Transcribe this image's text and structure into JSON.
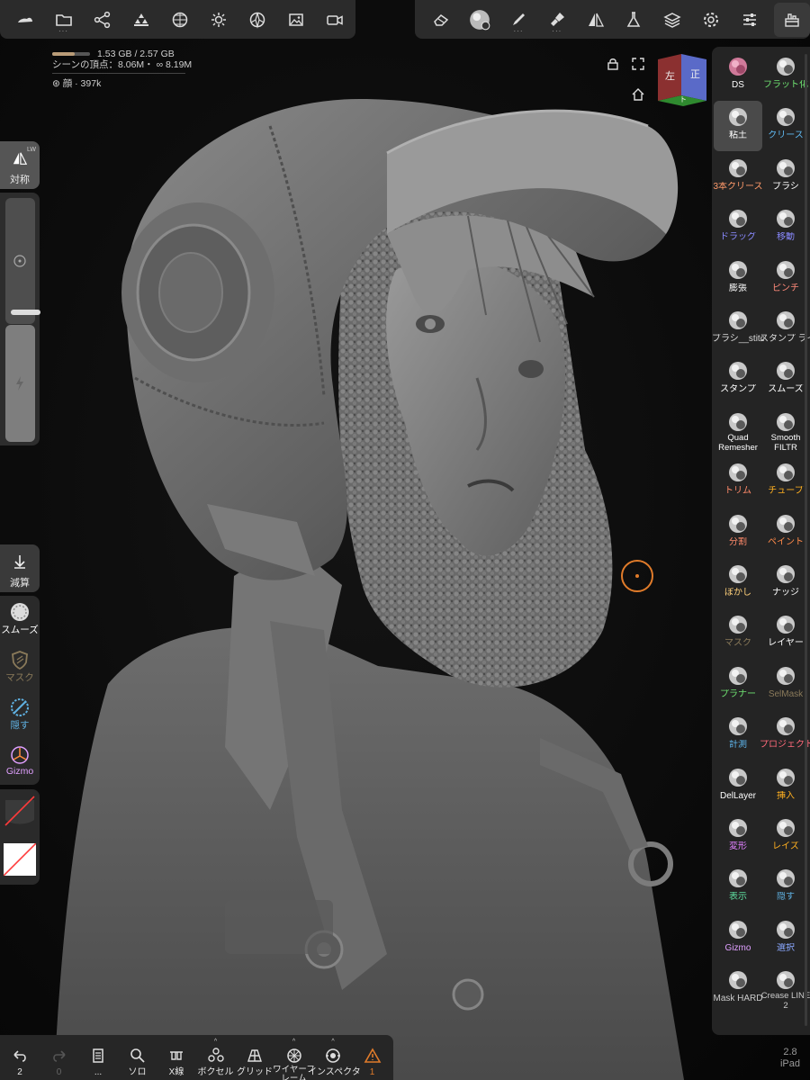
{
  "top_left_toolbar": [
    {
      "name": "cloud-icon",
      "dots": ""
    },
    {
      "name": "folder-icon",
      "dots": "···"
    },
    {
      "name": "scene-graph-icon",
      "dots": ""
    },
    {
      "name": "topology-icon",
      "dots": ""
    },
    {
      "name": "globe-icon",
      "dots": ""
    },
    {
      "name": "light-icon",
      "dots": ""
    },
    {
      "name": "material-icon",
      "dots": ""
    },
    {
      "name": "image-icon",
      "dots": ""
    },
    {
      "name": "video-icon",
      "dots": ""
    }
  ],
  "top_right_toolbar": [
    {
      "name": "eraser-icon",
      "dots": ""
    },
    {
      "name": "material-sphere-icon",
      "dots": ""
    },
    {
      "name": "brush-pen-icon",
      "dots": "···"
    },
    {
      "name": "paint-brush-icon",
      "dots": "···"
    },
    {
      "name": "symmetry-icon",
      "dots": ""
    },
    {
      "name": "flask-icon",
      "dots": ""
    },
    {
      "name": "layers-icon",
      "dots": ""
    },
    {
      "name": "settings-icon",
      "dots": ""
    },
    {
      "name": "sliders-icon",
      "dots": ""
    },
    {
      "name": "toolbox-icon",
      "dots": ""
    }
  ],
  "stats": {
    "memory": "1.53 GB / 2.57 GB",
    "memory_fraction": 0.6,
    "scene_vertices": "シーンの頂点：8.06M・",
    "link_count": "8.19M",
    "mesh_name": "顔",
    "mesh_count": "· 397k"
  },
  "nav_cube": {
    "left": "左",
    "front": "正",
    "bottom": "ト"
  },
  "left_panel": {
    "symmetry_label": "対称",
    "symmetry_tag": "LW",
    "radius_fraction": 0.93,
    "decimate_label": "減算",
    "tools": [
      {
        "label": "スムーズ",
        "color": "#ffffff"
      },
      {
        "label": "マスク",
        "color": "#8a7a5a"
      },
      {
        "label": "隠す",
        "color": "#5fb0e0"
      },
      {
        "label": "Gizmo",
        "color": "#e0a0ff"
      }
    ]
  },
  "right_tools": [
    {
      "label": "DS",
      "color": "#ffffff",
      "icon": "ds-icon",
      "selected": false
    },
    {
      "label": "フラット化",
      "color": "#6ee070",
      "icon": "flatten-icon",
      "selected": false
    },
    {
      "label": "粘土",
      "color": "#ffffff",
      "icon": "clay-icon",
      "selected": true
    },
    {
      "label": "クリース",
      "color": "#5fb8f0",
      "icon": "crease-icon",
      "selected": false
    },
    {
      "label": "3本クリース",
      "color": "#ff9a6a",
      "icon": "triple-crease-icon",
      "selected": false
    },
    {
      "label": "ブラシ",
      "color": "#ffffff",
      "icon": "brush-icon",
      "selected": false
    },
    {
      "label": "ドラッグ",
      "color": "#8a8aff",
      "icon": "drag-icon",
      "selected": false
    },
    {
      "label": "移動",
      "color": "#8a8aff",
      "icon": "move-icon",
      "selected": false
    },
    {
      "label": "膨張",
      "color": "#ffffff",
      "icon": "inflate-icon",
      "selected": false
    },
    {
      "label": "ピンチ",
      "color": "#ff8a7a",
      "icon": "pinch-icon",
      "selected": false
    },
    {
      "label": "ブラシ__stitch",
      "color": "#dddddd",
      "icon": "brush-stitch-icon",
      "selected": false
    },
    {
      "label": "スタンプ ライン",
      "color": "#dddddd",
      "icon": "stamp-line-icon",
      "selected": false
    },
    {
      "label": "スタンプ",
      "color": "#ffffff",
      "icon": "stamp-icon",
      "selected": false
    },
    {
      "label": "スムーズ",
      "color": "#ffffff",
      "icon": "smooth-icon",
      "selected": false
    },
    {
      "label": "Quad Remesher",
      "color": "#ffffff",
      "icon": "quad-remesher-icon",
      "selected": false
    },
    {
      "label": "Smooth FILTR",
      "color": "#ffffff",
      "icon": "smooth-filter-icon",
      "selected": false
    },
    {
      "label": "トリム",
      "color": "#ff8a6a",
      "icon": "trim-icon",
      "selected": false
    },
    {
      "label": "チューブ",
      "color": "#ffb020",
      "icon": "tube-icon",
      "selected": false
    },
    {
      "label": "分割",
      "color": "#ff8a6a",
      "icon": "split-icon",
      "selected": false
    },
    {
      "label": "ペイント",
      "color": "#ff8a4a",
      "icon": "paint-icon",
      "selected": false
    },
    {
      "label": "ぼかし",
      "color": "#ffd07a",
      "icon": "blur-icon",
      "selected": false
    },
    {
      "label": "ナッジ",
      "color": "#ffffff",
      "icon": "nudge-icon",
      "selected": false
    },
    {
      "label": "マスク",
      "color": "#8a7a5a",
      "icon": "mask-icon",
      "selected": false
    },
    {
      "label": "レイヤー",
      "color": "#ffffff",
      "icon": "layer-icon",
      "selected": false
    },
    {
      "label": "プラナー",
      "color": "#6ee070",
      "icon": "planar-icon",
      "selected": false
    },
    {
      "label": "SelMask",
      "color": "#8a7a5a",
      "icon": "selmask-icon",
      "selected": false
    },
    {
      "label": "計測",
      "color": "#5fb8f0",
      "icon": "measure-icon",
      "selected": false
    },
    {
      "label": "プロジェクト",
      "color": "#ff6a7a",
      "icon": "project-icon",
      "selected": false
    },
    {
      "label": "DelLayer",
      "color": "#ffffff",
      "icon": "del-layer-icon",
      "selected": false
    },
    {
      "label": "挿入",
      "color": "#ffb020",
      "icon": "insert-icon",
      "selected": false
    },
    {
      "label": "変形",
      "color": "#e080ff",
      "icon": "transform-icon",
      "selected": false
    },
    {
      "label": "レイズ",
      "color": "#ffb020",
      "icon": "raise-icon",
      "selected": false
    },
    {
      "label": "表示",
      "color": "#5fe0a0",
      "icon": "view-icon",
      "selected": false
    },
    {
      "label": "隠す",
      "color": "#5fb0e0",
      "icon": "hide-icon",
      "selected": false
    },
    {
      "label": "Gizmo",
      "color": "#e0a0ff",
      "icon": "gizmo-icon",
      "selected": false
    },
    {
      "label": "選択",
      "color": "#8aa8ff",
      "icon": "select-icon",
      "selected": false
    },
    {
      "label": "Mask HARD",
      "color": "#cccccc",
      "icon": "mask-hard-icon",
      "selected": false
    },
    {
      "label": "Crease LINE 2",
      "color": "#cccccc",
      "icon": "crease-line-icon",
      "selected": false
    }
  ],
  "bottom_bar": [
    {
      "name": "undo-button",
      "icon": "undo-icon",
      "label": "2",
      "caret": ""
    },
    {
      "name": "redo-button",
      "icon": "redo-icon",
      "label": "0",
      "caret": ""
    },
    {
      "name": "history-button",
      "icon": "history-icon",
      "label": "...",
      "caret": ""
    },
    {
      "name": "solo-button",
      "icon": "search-icon",
      "label": "ソロ",
      "caret": ""
    },
    {
      "name": "xray-button",
      "icon": "xray-icon",
      "label": "X線",
      "caret": ""
    },
    {
      "name": "voxel-button",
      "icon": "voxel-icon",
      "label": "ボクセル",
      "caret": "^"
    },
    {
      "name": "grid-button",
      "icon": "grid-icon",
      "label": "グリッド",
      "caret": ""
    },
    {
      "name": "wireframe-button",
      "icon": "wireframe-icon",
      "label": "ワイヤーフレーム",
      "caret": "^"
    },
    {
      "name": "inspector-button",
      "icon": "inspector-icon",
      "label": "インスペクタ",
      "caret": "^"
    },
    {
      "name": "warning-button",
      "icon": "warning-icon",
      "label": "1",
      "caret": ""
    }
  ],
  "version": {
    "number": "2.8",
    "device": "iPad"
  },
  "colors": {
    "accent": "#e07b2a",
    "panel": "#2b2b2b",
    "cube_left": "#8b3030",
    "cube_front": "#5a6ac8",
    "cube_bottom": "#2f8a2f"
  }
}
